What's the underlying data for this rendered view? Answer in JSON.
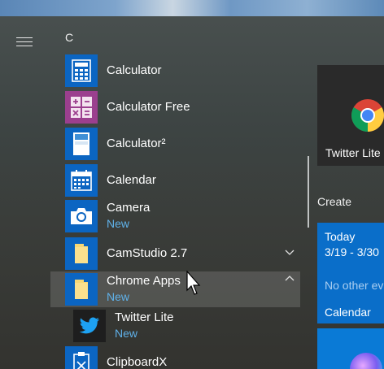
{
  "section_letter": "C",
  "apps": [
    {
      "name": "Calculator",
      "sub": "",
      "icon": "calculator-icon"
    },
    {
      "name": "Calculator Free",
      "sub": "",
      "icon": "calculator-free-icon"
    },
    {
      "name": "Calculator²",
      "sub": "",
      "icon": "calculator2-icon"
    },
    {
      "name": "Calendar",
      "sub": "",
      "icon": "calendar-icon"
    },
    {
      "name": "Camera",
      "sub": "New",
      "icon": "camera-icon"
    },
    {
      "name": "CamStudio 2.7",
      "sub": "",
      "icon": "folder-icon",
      "expandable": "chevron-down"
    },
    {
      "name": "Chrome Apps",
      "sub": "New",
      "icon": "folder-icon",
      "expandable": "chevron-up"
    },
    {
      "name": "Twitter Lite",
      "sub": "New",
      "icon": "twitter-icon"
    },
    {
      "name": "ClipboardX",
      "sub": "",
      "icon": "clipboard-icon"
    }
  ],
  "tiles": {
    "twitter": {
      "label": "Twitter Lite"
    },
    "group_label": "Create",
    "calendar": {
      "today": "Today",
      "dates": "3/19 - 3/30",
      "no_events": "No other ev",
      "label": "Calendar"
    }
  },
  "colors": {
    "accent": "#0a6ec9",
    "new_badge": "#5fb0e8"
  }
}
